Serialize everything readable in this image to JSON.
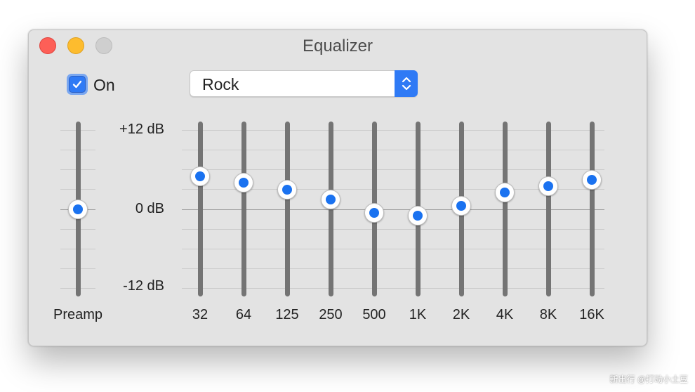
{
  "window": {
    "title": "Equalizer"
  },
  "traffic_lights": {
    "close_color": "#fd5f57",
    "minimize_color": "#fdbc2e",
    "zoom_color": "#cfcfcf"
  },
  "enable": {
    "label": "On",
    "checked": true
  },
  "preset": {
    "selected": "Rock"
  },
  "scale": {
    "top": "+12 dB",
    "mid": "0 dB",
    "bottom": "-12 dB",
    "max_db": 12,
    "min_db": -12
  },
  "preamp": {
    "label": "Preamp",
    "value_db": 0
  },
  "bands": [
    {
      "label": "32",
      "value_db": 5
    },
    {
      "label": "64",
      "value_db": 4
    },
    {
      "label": "125",
      "value_db": 3
    },
    {
      "label": "250",
      "value_db": 1.5
    },
    {
      "label": "500",
      "value_db": -0.5
    },
    {
      "label": "1K",
      "value_db": -1
    },
    {
      "label": "2K",
      "value_db": 0.5
    },
    {
      "label": "4K",
      "value_db": 2.5
    },
    {
      "label": "8K",
      "value_db": 3.5
    },
    {
      "label": "16K",
      "value_db": 4.5
    }
  ],
  "accent_color": "#1a72f0",
  "watermark": "新出行 @打动小土豆"
}
